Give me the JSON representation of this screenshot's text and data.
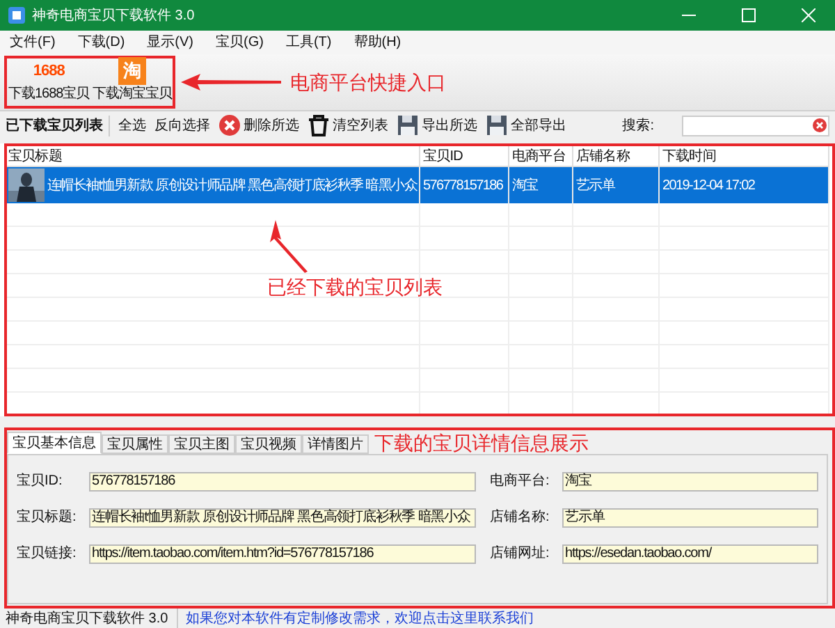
{
  "window": {
    "title": "神奇电商宝贝下载软件 3.0"
  },
  "menu": [
    "文件(F)",
    "下载(D)",
    "显示(V)",
    "宝贝(G)",
    "工具(T)",
    "帮助(H)"
  ],
  "quick_links": [
    {
      "kind": "wholesale",
      "icon_text": "1688",
      "label": "下载1688宝贝"
    },
    {
      "kind": "taobao",
      "icon_text": "淘",
      "label": "下载淘宝宝贝"
    }
  ],
  "toolbar": [
    {
      "kind": "title",
      "label": "已下载宝贝列表"
    },
    {
      "kind": "text",
      "label": "全选"
    },
    {
      "kind": "text",
      "label": "反向选择"
    },
    {
      "kind": "delete",
      "label": "删除所选"
    },
    {
      "kind": "clear",
      "label": "清空列表"
    },
    {
      "kind": "save",
      "label": "导出所选"
    },
    {
      "kind": "save",
      "label": "全部导出"
    }
  ],
  "search": {
    "label": "搜索:"
  },
  "table": {
    "columns": [
      "宝贝标题",
      "宝贝ID",
      "电商平台",
      "店铺名称",
      "下载时间"
    ],
    "rows": [
      {
        "selected": true,
        "cells": [
          "连帽长袖t恤男新款 原创设计师品牌 黑色高领打底衫秋季 暗黑小众",
          "576778157186",
          "淘宝",
          "艺示单",
          "2019-12-04 17:02"
        ]
      }
    ]
  },
  "detail_tabs": [
    {
      "label": "宝贝基本信息",
      "selected": true
    },
    {
      "label": "宝贝属性",
      "selected": false
    },
    {
      "label": "宝贝主图",
      "selected": false
    },
    {
      "label": "宝贝视频",
      "selected": false
    },
    {
      "label": "详情图片",
      "selected": false
    }
  ],
  "fields": [
    {
      "label": "宝贝ID:",
      "value": "576778157186"
    },
    {
      "label": "电商平台:",
      "value": "淘宝"
    },
    {
      "label": "宝贝标题:",
      "value": "连帽长袖t恤男新款 原创设计师品牌 黑色高领打底衫秋季 暗黑小众"
    },
    {
      "label": "店铺名称:",
      "value": "艺示单"
    },
    {
      "label": "宝贝链接:",
      "value": "https://item.taobao.com/item.htm?id=576778157186"
    },
    {
      "label": "店铺网址:",
      "value": "https://esedan.taobao.com/"
    }
  ],
  "status_bar": {
    "app": "神奇电商宝贝下载软件 3.0",
    "link": "如果您对本软件有定制修改需求，欢迎点击这里联系我们"
  },
  "annotations": [
    "电商平台快捷入口",
    "已经下载的宝贝列表",
    "下载的宝贝详情信息展示"
  ]
}
